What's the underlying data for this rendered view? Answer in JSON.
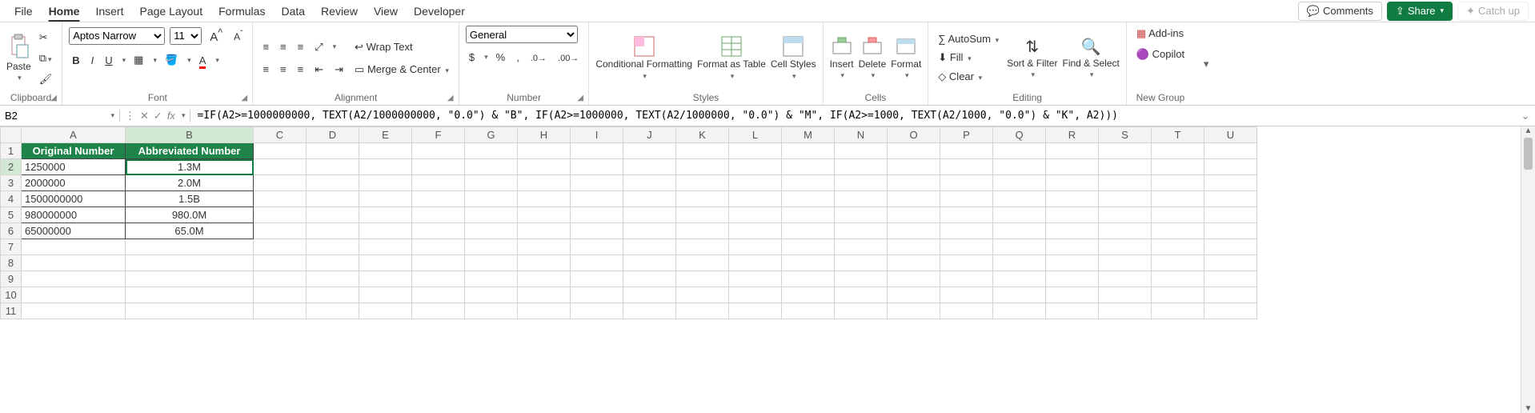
{
  "menu": {
    "tabs": [
      "File",
      "Home",
      "Insert",
      "Page Layout",
      "Formulas",
      "Data",
      "Review",
      "View",
      "Developer"
    ],
    "active": "Home",
    "comments": "Comments",
    "share": "Share",
    "catchup": "Catch up"
  },
  "ribbon": {
    "clipboard": {
      "paste": "Paste",
      "label": "Clipboard"
    },
    "font": {
      "name": "Aptos Narrow",
      "size": "11",
      "label": "Font"
    },
    "alignment": {
      "wrap": "Wrap Text",
      "merge": "Merge & Center",
      "label": "Alignment"
    },
    "number": {
      "format": "General",
      "label": "Number"
    },
    "styles": {
      "cond": "Conditional Formatting",
      "table": "Format as Table",
      "cell": "Cell Styles",
      "label": "Styles"
    },
    "cells": {
      "insert": "Insert",
      "delete": "Delete",
      "format": "Format",
      "label": "Cells"
    },
    "editing": {
      "autosum": "AutoSum",
      "fill": "Fill",
      "clear": "Clear",
      "sort": "Sort & Filter",
      "find": "Find & Select",
      "label": "Editing"
    },
    "newgroup": {
      "addins": "Add-ins",
      "copilot": "Copilot",
      "label": "New Group"
    }
  },
  "formula_bar": {
    "cell_ref": "B2",
    "formula": "=IF(A2>=1000000000, TEXT(A2/1000000000, \"0.0\") & \"B\", IF(A2>=1000000, TEXT(A2/1000000, \"0.0\") & \"M\", IF(A2>=1000, TEXT(A2/1000, \"0.0\") & \"K\", A2)))"
  },
  "grid": {
    "columns": [
      "A",
      "B",
      "C",
      "D",
      "E",
      "F",
      "G",
      "H",
      "I",
      "J",
      "K",
      "L",
      "M",
      "N",
      "O",
      "P",
      "Q",
      "R",
      "S",
      "T",
      "U"
    ],
    "row_count": 11,
    "headers": {
      "A": "Original Number",
      "B": "Abbreviated Number"
    },
    "data": [
      {
        "A": "1250000",
        "B": "1.3M"
      },
      {
        "A": "2000000",
        "B": "2.0M"
      },
      {
        "A": "1500000000",
        "B": "1.5B"
      },
      {
        "A": "980000000",
        "B": "980.0M"
      },
      {
        "A": "65000000",
        "B": "65.0M"
      }
    ],
    "selected": "B2"
  }
}
